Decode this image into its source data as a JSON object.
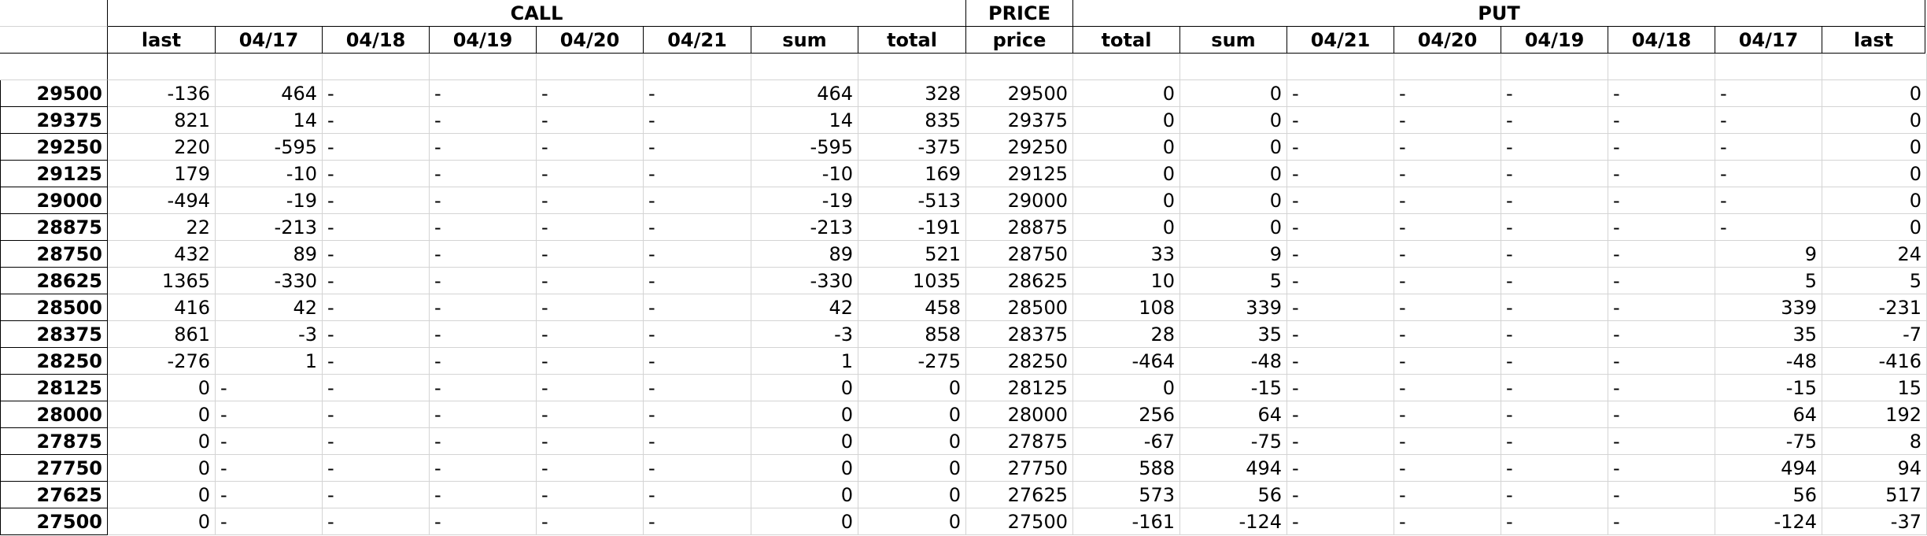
{
  "headers": {
    "group_call": "CALL",
    "group_price": "PRICE",
    "group_put": "PUT",
    "call_cols": [
      "last",
      "04/17",
      "04/18",
      "04/19",
      "04/20",
      "04/21",
      "sum",
      "total"
    ],
    "price_col": "price",
    "put_cols": [
      "total",
      "sum",
      "04/21",
      "04/20",
      "04/19",
      "04/18",
      "04/17",
      "last"
    ]
  },
  "rows": [
    {
      "strike": "29500",
      "call": [
        "-136",
        "464",
        "-",
        "-",
        "-",
        "-",
        "464",
        "328"
      ],
      "price": "29500",
      "put": [
        "0",
        "0",
        "-",
        "-",
        "-",
        "-",
        "-",
        "0"
      ]
    },
    {
      "strike": "29375",
      "call": [
        "821",
        "14",
        "-",
        "-",
        "-",
        "-",
        "14",
        "835"
      ],
      "price": "29375",
      "put": [
        "0",
        "0",
        "-",
        "-",
        "-",
        "-",
        "-",
        "0"
      ]
    },
    {
      "strike": "29250",
      "call": [
        "220",
        "-595",
        "-",
        "-",
        "-",
        "-",
        "-595",
        "-375"
      ],
      "price": "29250",
      "put": [
        "0",
        "0",
        "-",
        "-",
        "-",
        "-",
        "-",
        "0"
      ]
    },
    {
      "strike": "29125",
      "call": [
        "179",
        "-10",
        "-",
        "-",
        "-",
        "-",
        "-10",
        "169"
      ],
      "price": "29125",
      "put": [
        "0",
        "0",
        "-",
        "-",
        "-",
        "-",
        "-",
        "0"
      ]
    },
    {
      "strike": "29000",
      "call": [
        "-494",
        "-19",
        "-",
        "-",
        "-",
        "-",
        "-19",
        "-513"
      ],
      "price": "29000",
      "put": [
        "0",
        "0",
        "-",
        "-",
        "-",
        "-",
        "-",
        "0"
      ]
    },
    {
      "strike": "28875",
      "call": [
        "22",
        "-213",
        "-",
        "-",
        "-",
        "-",
        "-213",
        "-191"
      ],
      "price": "28875",
      "put": [
        "0",
        "0",
        "-",
        "-",
        "-",
        "-",
        "-",
        "0"
      ]
    },
    {
      "strike": "28750",
      "call": [
        "432",
        "89",
        "-",
        "-",
        "-",
        "-",
        "89",
        "521"
      ],
      "price": "28750",
      "put": [
        "33",
        "9",
        "-",
        "-",
        "-",
        "-",
        "9",
        "24"
      ]
    },
    {
      "strike": "28625",
      "call": [
        "1365",
        "-330",
        "-",
        "-",
        "-",
        "-",
        "-330",
        "1035"
      ],
      "price": "28625",
      "put": [
        "10",
        "5",
        "-",
        "-",
        "-",
        "-",
        "5",
        "5"
      ]
    },
    {
      "strike": "28500",
      "call": [
        "416",
        "42",
        "-",
        "-",
        "-",
        "-",
        "42",
        "458"
      ],
      "price": "28500",
      "put": [
        "108",
        "339",
        "-",
        "-",
        "-",
        "-",
        "339",
        "-231"
      ]
    },
    {
      "strike": "28375",
      "call": [
        "861",
        "-3",
        "-",
        "-",
        "-",
        "-",
        "-3",
        "858"
      ],
      "price": "28375",
      "put": [
        "28",
        "35",
        "-",
        "-",
        "-",
        "-",
        "35",
        "-7"
      ]
    },
    {
      "strike": "28250",
      "call": [
        "-276",
        "1",
        "-",
        "-",
        "-",
        "-",
        "1",
        "-275"
      ],
      "price": "28250",
      "put": [
        "-464",
        "-48",
        "-",
        "-",
        "-",
        "-",
        "-48",
        "-416"
      ]
    },
    {
      "strike": "28125",
      "call": [
        "0",
        "-",
        "-",
        "-",
        "-",
        "-",
        "0",
        "0"
      ],
      "price": "28125",
      "put": [
        "0",
        "-15",
        "-",
        "-",
        "-",
        "-",
        "-15",
        "15"
      ]
    },
    {
      "strike": "28000",
      "call": [
        "0",
        "-",
        "-",
        "-",
        "-",
        "-",
        "0",
        "0"
      ],
      "price": "28000",
      "put": [
        "256",
        "64",
        "-",
        "-",
        "-",
        "-",
        "64",
        "192"
      ]
    },
    {
      "strike": "27875",
      "call": [
        "0",
        "-",
        "-",
        "-",
        "-",
        "-",
        "0",
        "0"
      ],
      "price": "27875",
      "put": [
        "-67",
        "-75",
        "-",
        "-",
        "-",
        "-",
        "-75",
        "8"
      ]
    },
    {
      "strike": "27750",
      "call": [
        "0",
        "-",
        "-",
        "-",
        "-",
        "-",
        "0",
        "0"
      ],
      "price": "27750",
      "put": [
        "588",
        "494",
        "-",
        "-",
        "-",
        "-",
        "494",
        "94"
      ]
    },
    {
      "strike": "27625",
      "call": [
        "0",
        "-",
        "-",
        "-",
        "-",
        "-",
        "0",
        "0"
      ],
      "price": "27625",
      "put": [
        "573",
        "56",
        "-",
        "-",
        "-",
        "-",
        "56",
        "517"
      ]
    },
    {
      "strike": "27500",
      "call": [
        "0",
        "-",
        "-",
        "-",
        "-",
        "-",
        "0",
        "0"
      ],
      "price": "27500",
      "put": [
        "-161",
        "-124",
        "-",
        "-",
        "-",
        "-",
        "-124",
        "-37"
      ]
    }
  ]
}
